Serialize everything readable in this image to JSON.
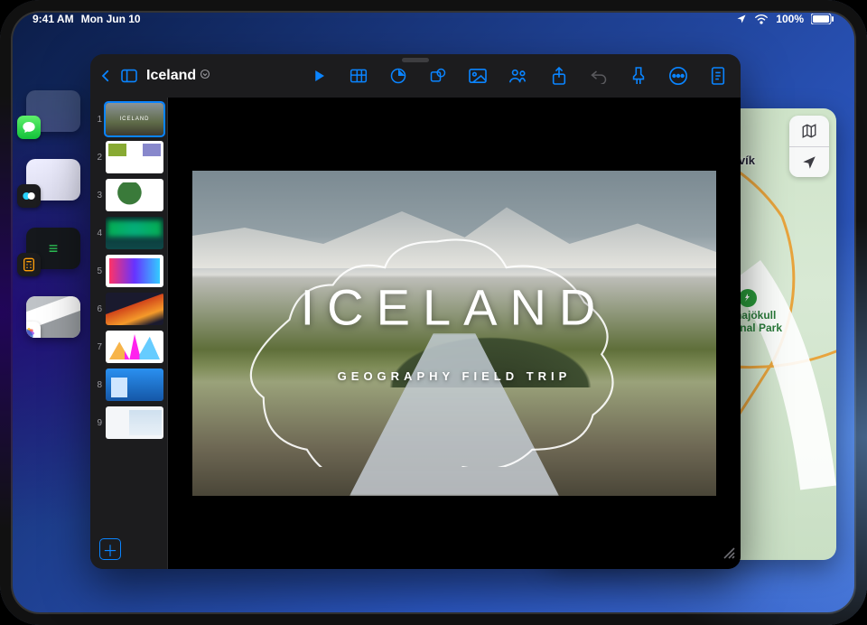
{
  "status": {
    "time": "9:41 AM",
    "date": "Mon Jun 10",
    "battery_pct": "100%"
  },
  "stage": {
    "apps": [
      "messages",
      "translate",
      "stocks",
      "calculator",
      "photos"
    ]
  },
  "maps": {
    "city_label": "Húsavík",
    "park_label": "Vatnajökull\nNational Park"
  },
  "keynote": {
    "doc_title": "Iceland",
    "slide_title": "ICELAND",
    "slide_subtitle": "GEOGRAPHY FIELD TRIP",
    "thumbs": [
      {
        "n": "1",
        "variant": "t1",
        "label": "ICELAND"
      },
      {
        "n": "2",
        "variant": "t2",
        "label": ""
      },
      {
        "n": "3",
        "variant": "t3",
        "label": ""
      },
      {
        "n": "4",
        "variant": "t4",
        "label": ""
      },
      {
        "n": "5",
        "variant": "t5",
        "label": ""
      },
      {
        "n": "6",
        "variant": "t6",
        "label": ""
      },
      {
        "n": "7",
        "variant": "t7",
        "label": ""
      },
      {
        "n": "8",
        "variant": "t8",
        "label": ""
      },
      {
        "n": "9",
        "variant": "t9",
        "label": ""
      }
    ],
    "toolbar_icons": [
      "play",
      "table",
      "chart",
      "shape",
      "image",
      "collaborate",
      "share",
      "undo",
      "format-brush",
      "more",
      "document"
    ]
  }
}
